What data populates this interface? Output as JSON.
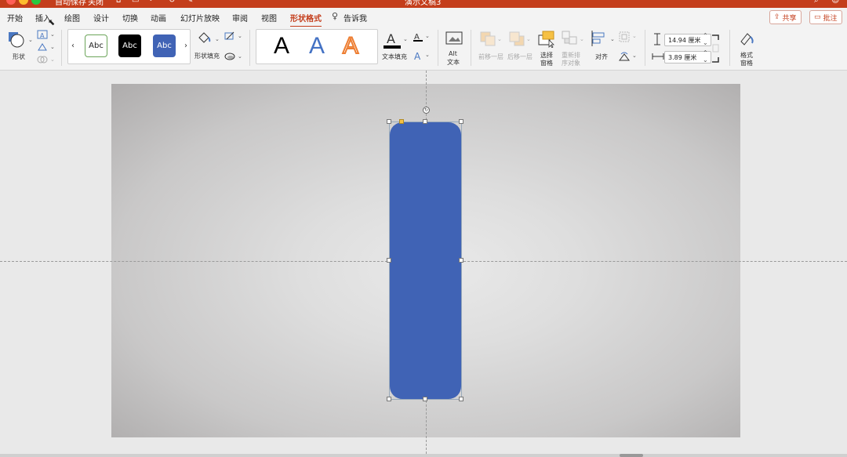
{
  "titlebar": {
    "autosave": "自动保存",
    "toggle": "关闭",
    "doc_title": "演示文稿3"
  },
  "tabs": [
    {
      "label": "开始"
    },
    {
      "label": "插入"
    },
    {
      "label": "绘图"
    },
    {
      "label": "设计"
    },
    {
      "label": "切换"
    },
    {
      "label": "动画"
    },
    {
      "label": "幻灯片放映"
    },
    {
      "label": "审阅"
    },
    {
      "label": "视图"
    },
    {
      "label": "形状格式"
    },
    {
      "label": "告诉我"
    }
  ],
  "active_tab": "形状格式",
  "actions": {
    "share": "共享",
    "comment": "批注"
  },
  "ribbon": {
    "shape_label": "形状",
    "style_presets": [
      "Abc",
      "Abc",
      "Abc"
    ],
    "shape_fill": "形状填充",
    "wordart_letters": [
      "A",
      "A",
      "A"
    ],
    "text_fill": "文本填充",
    "alt_text_line1": "Alt",
    "alt_text_line2": "文本",
    "bring_forward": "前移一层",
    "send_backward": "后移一层",
    "selection_pane_line1": "选择",
    "selection_pane_line2": "窗格",
    "reorder_line1": "重新排",
    "reorder_line2": "序对象",
    "align": "对齐",
    "height_value": "14.94 厘米",
    "width_value": "3.89 厘米",
    "format_pane_line1": "格式",
    "format_pane_line2": "窗格"
  },
  "colors": {
    "accent": "#c43e1c",
    "shape_fill": "#4063b5",
    "style_preset_1_bg": "#ffffff",
    "style_preset_2_bg": "#000000",
    "style_preset_3_bg": "#4063b5",
    "wordart_1": "#000000",
    "wordart_2": "#4472c4",
    "wordart_3": "#ed7d31"
  },
  "icons": [
    "shape-circle-icon",
    "text-box-icon",
    "edit-shape-icon",
    "merge-shapes-icon",
    "paint-bucket-icon",
    "pen-outline-icon",
    "shape-effects-icon",
    "text-fill-icon",
    "text-outline-icon",
    "text-effects-icon",
    "alt-text-icon",
    "bring-forward-icon",
    "send-backward-icon",
    "selection-pane-icon",
    "reorder-icon",
    "align-icon",
    "group-icon",
    "rotate-icon",
    "height-icon",
    "width-icon",
    "crop-icon",
    "format-pane-icon",
    "lightbulb-icon",
    "share-icon",
    "comment-icon"
  ]
}
